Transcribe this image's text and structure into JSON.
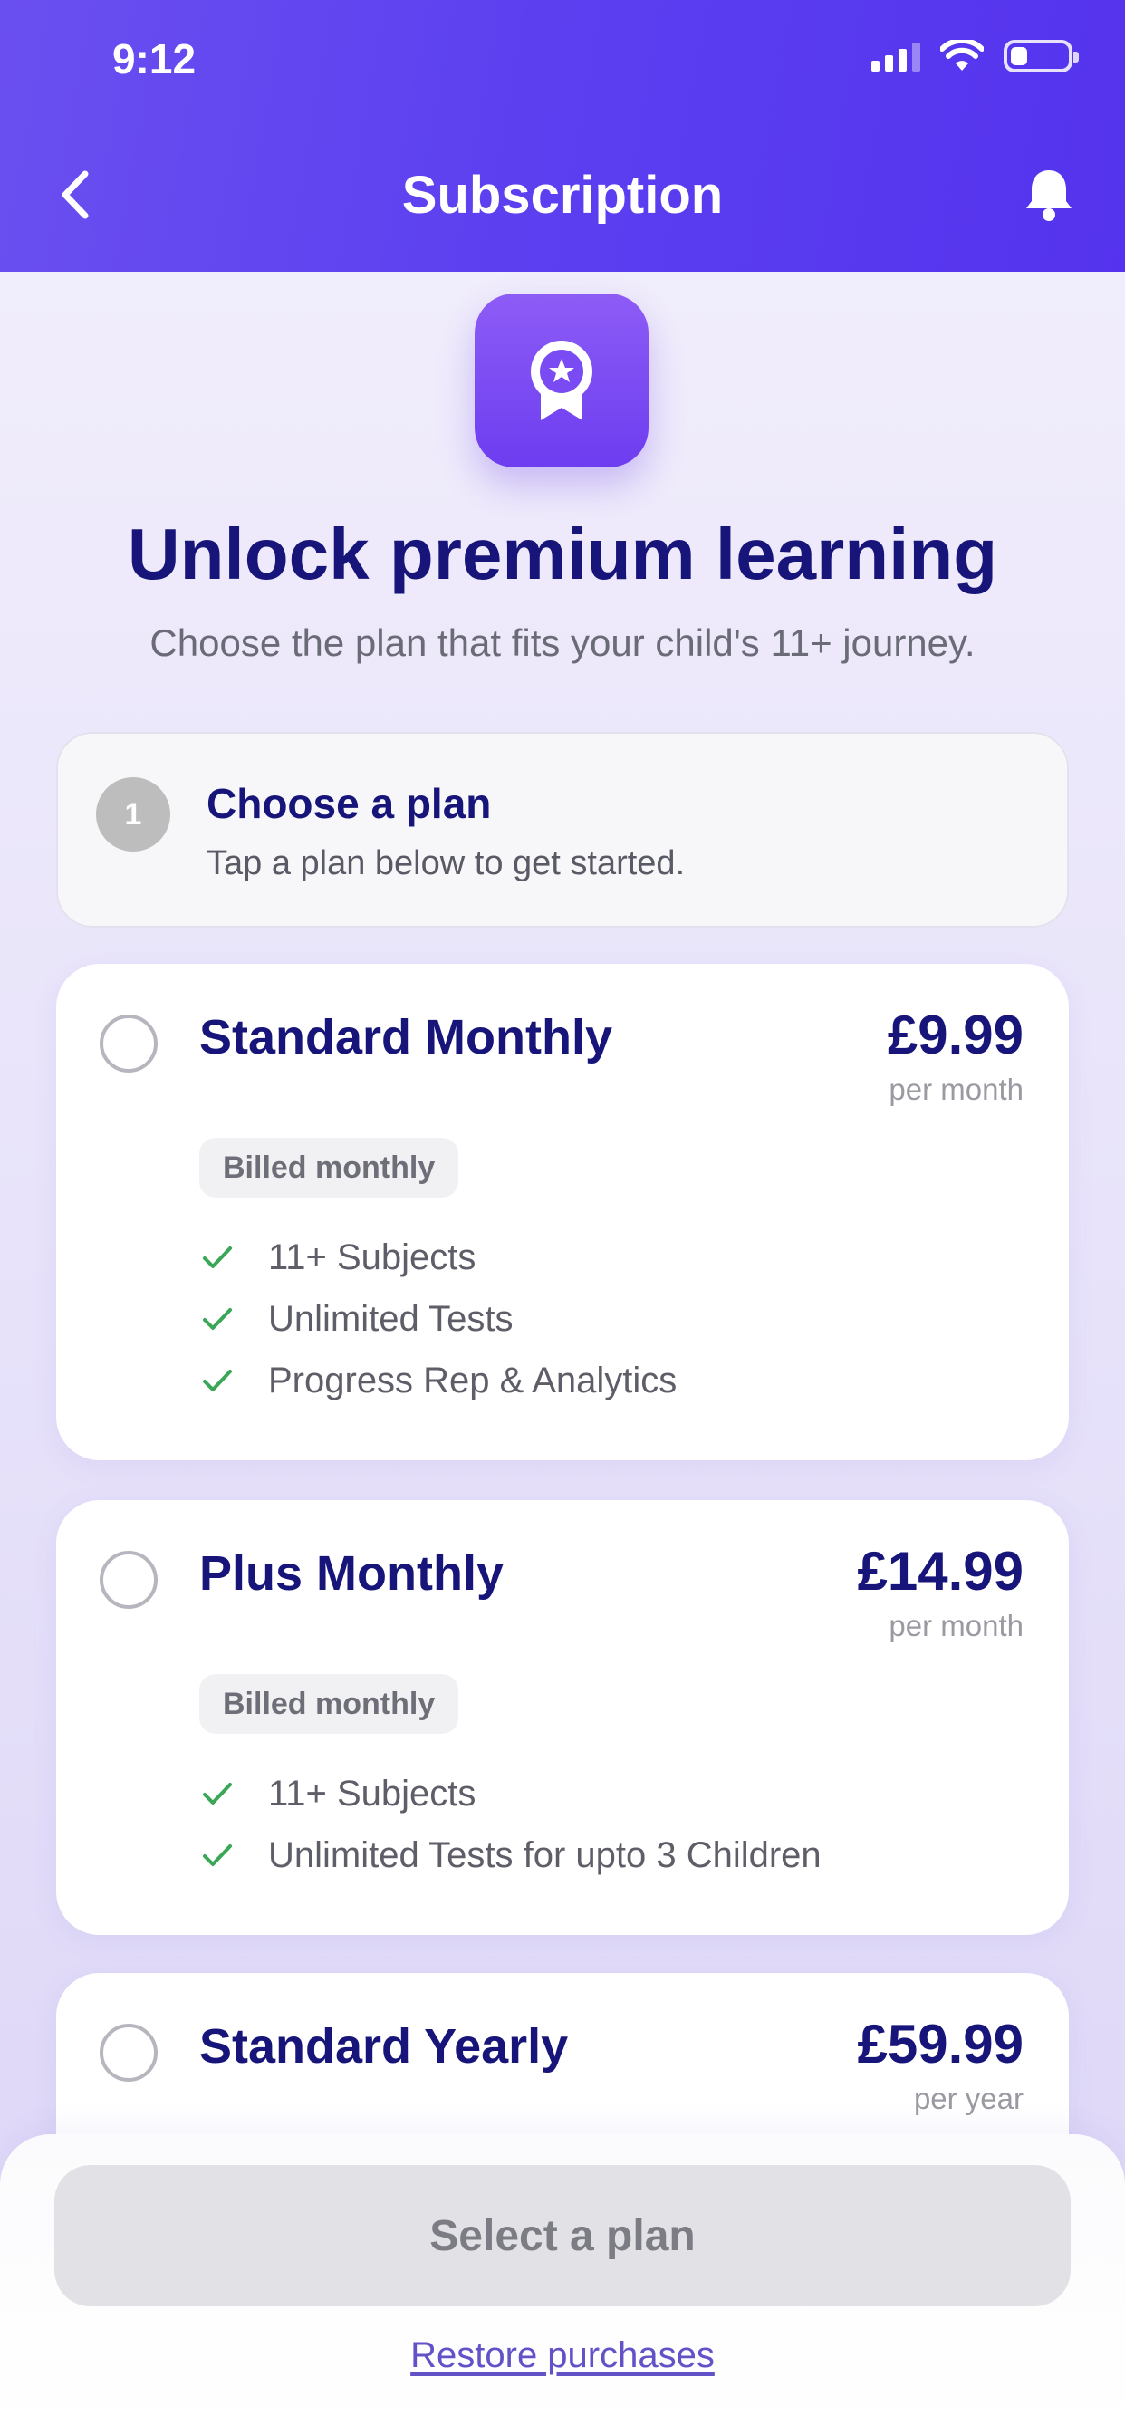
{
  "status_bar": {
    "time": "9:12"
  },
  "nav": {
    "title": "Subscription",
    "back_icon": "chevron-left-icon",
    "notification_icon": "bell-icon"
  },
  "hero": {
    "icon": "ribbon-star-badge-icon",
    "title": "Unlock premium learning",
    "subtitle": "Choose the plan that fits your child's 11+ journey."
  },
  "step": {
    "number": "1",
    "title": "Choose a plan",
    "description": "Tap a plan below to get started."
  },
  "plans": [
    {
      "name": "Standard Monthly",
      "price": "£9.99",
      "period": "per month",
      "billing": "Billed monthly",
      "features": [
        "11+ Subjects",
        "Unlimited Tests",
        "Progress Rep & Analytics"
      ]
    },
    {
      "name": "Plus Monthly",
      "price": "£14.99",
      "period": "per month",
      "billing": "Billed monthly",
      "features": [
        "11+ Subjects",
        "Unlimited Tests for upto 3 Children"
      ]
    },
    {
      "name": "Standard Yearly",
      "price": "£59.99",
      "period": "per year"
    }
  ],
  "actions": {
    "select_label": "Select a plan",
    "restore_label": "Restore purchases"
  },
  "colors": {
    "header": "#5b3ff0",
    "title": "#17157a",
    "check": "#3aa757",
    "link": "#6152c8"
  }
}
